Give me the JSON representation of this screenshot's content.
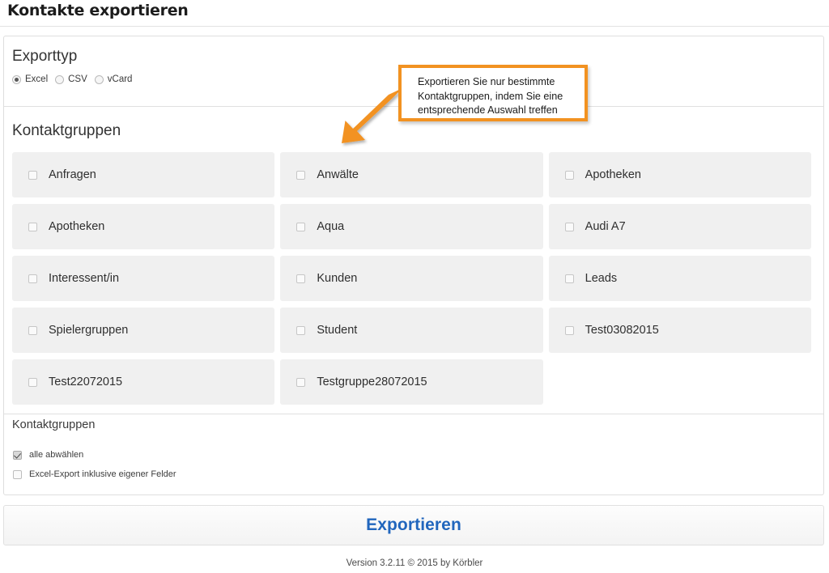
{
  "page": {
    "title": "Kontakte exportieren"
  },
  "export_type": {
    "heading": "Exporttyp",
    "options": [
      {
        "label": "Excel",
        "selected": true
      },
      {
        "label": "CSV",
        "selected": false
      },
      {
        "label": "vCard",
        "selected": false
      }
    ]
  },
  "contact_groups": {
    "heading": "Kontaktgruppen",
    "rows": [
      [
        {
          "label": "Anfragen",
          "checked": false
        },
        {
          "label": "Anwälte",
          "checked": false
        },
        {
          "label": "Apotheken",
          "checked": false
        }
      ],
      [
        {
          "label": "Apotheken",
          "checked": false
        },
        {
          "label": "Aqua",
          "checked": false
        },
        {
          "label": "Audi A7",
          "checked": false
        }
      ],
      [
        {
          "label": "Interessent/in",
          "checked": false
        },
        {
          "label": "Kunden",
          "checked": false
        },
        {
          "label": "Leads",
          "checked": false
        }
      ],
      [
        {
          "label": "Spielergruppen",
          "checked": false
        },
        {
          "label": "Student",
          "checked": false
        },
        {
          "label": "Test03082015",
          "checked": false
        }
      ],
      [
        {
          "label": "Test22072015",
          "checked": false
        },
        {
          "label": "Testgruppe28072015",
          "checked": false
        }
      ]
    ]
  },
  "options_section": {
    "heading": "Kontaktgruppen",
    "items": [
      {
        "label": "alle abwählen",
        "checked": true
      },
      {
        "label": "Excel-Export inklusive eigener Felder",
        "checked": false
      }
    ]
  },
  "footer": {
    "export_button": "Exportieren",
    "version": "Version 3.2.11 © 2015 by Körbler"
  },
  "callout": {
    "text": "Exportieren Sie nur bestimmte\nKontaktgruppen, indem Sie eine\nentsprechende Auswahl treffen",
    "border_color": "#f29221",
    "arrow_color": "#f29221"
  },
  "colors": {
    "accent_blue": "#2166bd",
    "tile_bg": "#f0f0f0",
    "panel_border": "#dedede",
    "highlight_orange": "#f29221"
  }
}
